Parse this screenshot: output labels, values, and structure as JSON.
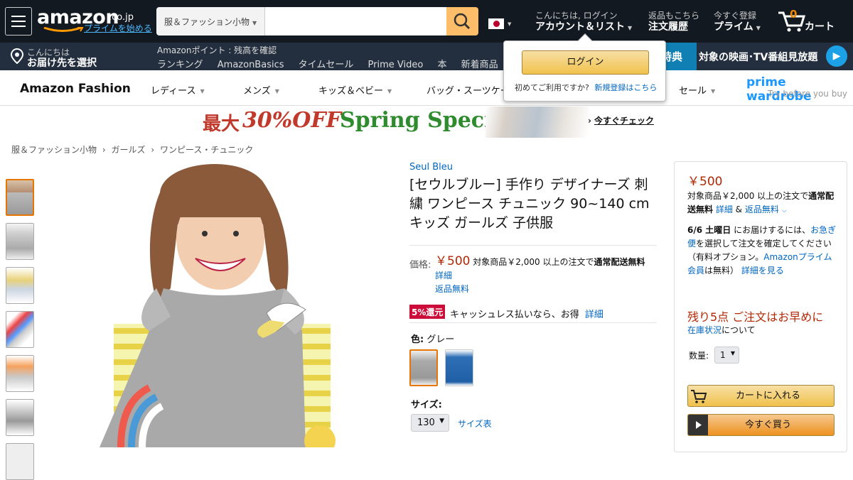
{
  "nav": {
    "logo": "amazon",
    "logo_suffix": ".co.jp",
    "prime_link": "プライムを始める",
    "search_category": "服＆ファッション小物",
    "search_value": "",
    "account_small": "こんにちは, ログイン",
    "account_big": "アカウント＆リスト",
    "orders_small": "返品もこちら",
    "orders_big": "注文履歴",
    "prime_small": "今すぐ登録",
    "prime_big": "プライム",
    "cart_count": "0",
    "cart_label": "カート"
  },
  "subnav": {
    "deliver_small": "こんにちは",
    "deliver_big": "お届け先を選択",
    "points_text": "Amazonポイント : 残高を確認",
    "links": [
      "ランキング",
      "AmazonBasics",
      "タイムセール",
      "Prime Video",
      "本",
      "新着商品"
    ],
    "promo_badge": "特典",
    "promo_text": "対象の映画･TV番組見放題"
  },
  "signin_flyout": {
    "login_button": "ログイン",
    "new_customer_text": "初めてご利用ですか?",
    "register_link": "新規登録はこちら"
  },
  "fashion": {
    "title": "Amazon Fashion",
    "menu": [
      "レディース",
      "メンズ",
      "キッズ＆ベビー",
      "バッグ・スーツケース",
      "セール"
    ],
    "prime_wardrobe": "prime wardrobe",
    "prime_wardrobe_sub": "Try before you buy"
  },
  "banner": {
    "text_a": "最大",
    "text_b": "30%OFF",
    "text_c": "Spring Special",
    "cta": "今すぐチェック"
  },
  "breadcrumb": [
    "服＆ファッション小物",
    "ガールズ",
    "ワンピース・チュニック"
  ],
  "product": {
    "brand": "Seul Bleu",
    "title": "[セウルブルー] 手作り デザイナーズ 刺繍 ワンピース チュニック 90~140 cm キッズ ガールズ 子供服",
    "price_label": "価格:",
    "price": "￥500",
    "shipping_text": "対象商品￥2,000 以上の注文で",
    "shipping_bold": "通常配送無料",
    "details_link": "詳細",
    "returns_link": "返品無料",
    "cashback_badge": "5%還元",
    "cashback_text": "キャッシュレス払いなら、お得",
    "cashback_link": "詳細",
    "color_label": "色:",
    "color_value": "グレー",
    "size_label": "サイズ:",
    "size_value": "130",
    "size_chart": "サイズ表"
  },
  "buybox": {
    "price": "￥500",
    "ship_text": "対象商品￥2,000 以上の注文で",
    "ship_bold": "通常配送無料",
    "ship_details": "詳細",
    "returns": "返品無料",
    "delivery_date": "6/6 土曜日",
    "delivery_text_1": "にお届けするには、",
    "delivery_link": "お急ぎ便",
    "delivery_text_2": "を選択して注文を確定してください（有料オプション。",
    "prime_link": "Amazonプライム会員",
    "delivery_text_3": "は無料）",
    "more_link": "詳細を見る",
    "stock_warning": "残り5点 ご注文はお早めに",
    "stock_link": "在庫状況",
    "stock_text": "について",
    "qty_label": "数量:",
    "qty_value": "1",
    "add_to_cart": "カートに入れる",
    "buy_now": "今すぐ買う"
  },
  "colors": {
    "nav_bg": "#131921",
    "subnav_bg": "#232f3e",
    "search_btn": "#febd69",
    "price_red": "#b12704",
    "link": "#0066c0"
  }
}
